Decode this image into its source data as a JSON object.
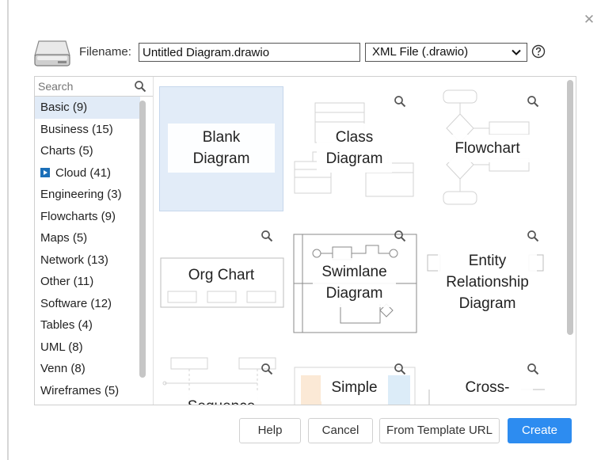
{
  "dialog": {
    "filename_label": "Filename:",
    "filename_value": "Untitled Diagram.drawio",
    "format_selected": "XML File (.drawio)"
  },
  "search": {
    "placeholder": "Search"
  },
  "categories": [
    {
      "label": "Basic (9)",
      "selected": true
    },
    {
      "label": "Business (15)"
    },
    {
      "label": "Charts (5)"
    },
    {
      "label": "Cloud (41)",
      "icon": "cloud-expand-icon"
    },
    {
      "label": "Engineering (3)"
    },
    {
      "label": "Flowcharts (9)"
    },
    {
      "label": "Maps (5)"
    },
    {
      "label": "Network (13)"
    },
    {
      "label": "Other (11)"
    },
    {
      "label": "Software (12)"
    },
    {
      "label": "Tables (4)"
    },
    {
      "label": "UML (8)"
    },
    {
      "label": "Venn (8)"
    },
    {
      "label": "Wireframes (5)"
    }
  ],
  "templates": [
    {
      "name": "blank",
      "label_lines": [
        "Blank",
        "Diagram"
      ],
      "selected": true
    },
    {
      "name": "class",
      "label_lines": [
        "Class",
        "Diagram"
      ]
    },
    {
      "name": "flowchart",
      "label_lines": [
        "Flowchart"
      ]
    },
    {
      "name": "org-chart",
      "label_lines": [
        "Org Chart"
      ]
    },
    {
      "name": "swimlane",
      "label_lines": [
        "Swimlane",
        "Diagram"
      ]
    },
    {
      "name": "entity-relationship",
      "label_lines": [
        "Entity",
        "Relationship",
        "Diagram"
      ]
    },
    {
      "name": "sequence",
      "label_lines": [
        "Sequence"
      ]
    },
    {
      "name": "simple",
      "label_lines": [
        "Simple"
      ]
    },
    {
      "name": "cross",
      "label_lines": [
        "Cross-"
      ]
    }
  ],
  "buttons": {
    "help": "Help",
    "cancel": "Cancel",
    "from_template_url": "From Template URL",
    "create": "Create"
  },
  "colors": {
    "accent": "#2d8cf0",
    "selection": "#e2ecf8",
    "cloud_badge": "#1b6fb8"
  }
}
